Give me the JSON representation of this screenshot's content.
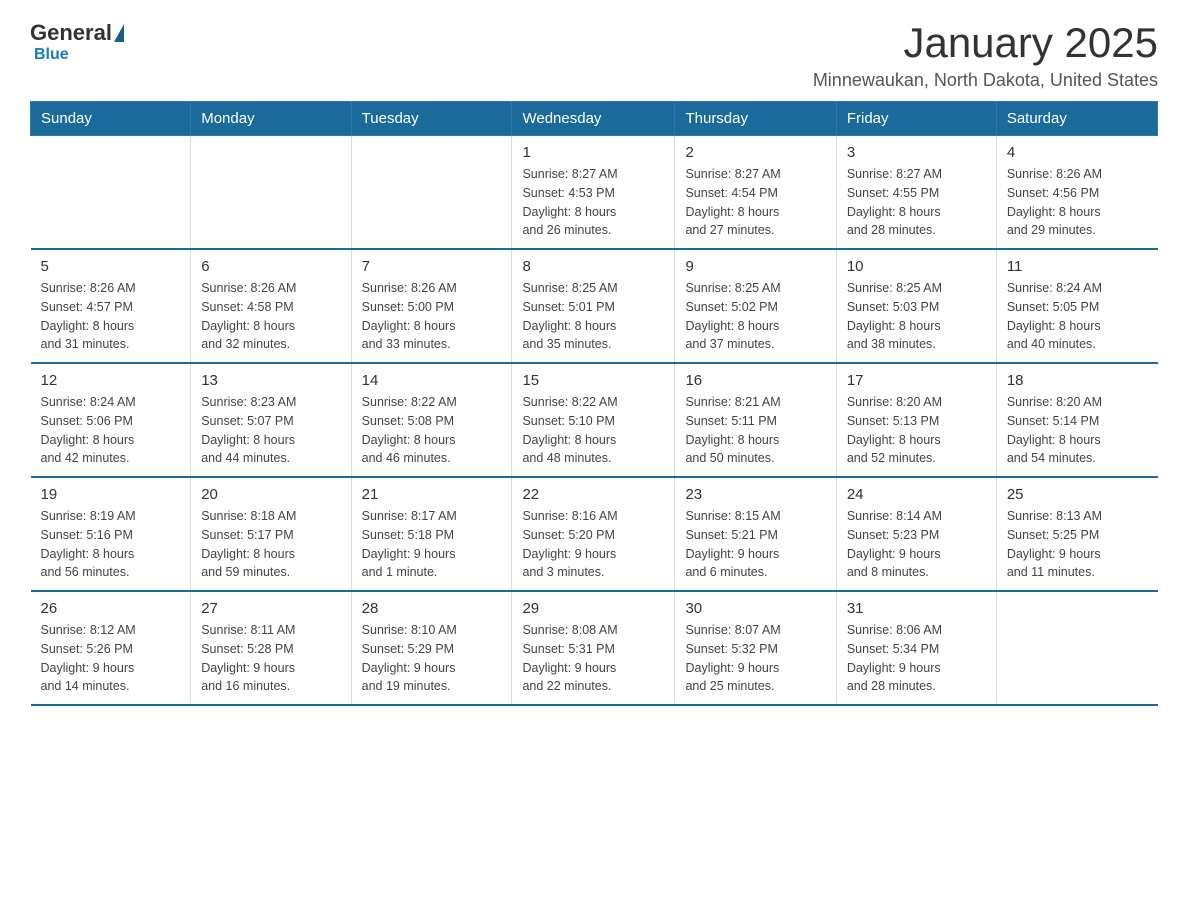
{
  "logo": {
    "general": "General",
    "blue": "Blue"
  },
  "header": {
    "month_title": "January 2025",
    "location": "Minnewaukan, North Dakota, United States"
  },
  "days_of_week": [
    "Sunday",
    "Monday",
    "Tuesday",
    "Wednesday",
    "Thursday",
    "Friday",
    "Saturday"
  ],
  "weeks": [
    [
      {
        "day": "",
        "info": ""
      },
      {
        "day": "",
        "info": ""
      },
      {
        "day": "",
        "info": ""
      },
      {
        "day": "1",
        "info": "Sunrise: 8:27 AM\nSunset: 4:53 PM\nDaylight: 8 hours\nand 26 minutes."
      },
      {
        "day": "2",
        "info": "Sunrise: 8:27 AM\nSunset: 4:54 PM\nDaylight: 8 hours\nand 27 minutes."
      },
      {
        "day": "3",
        "info": "Sunrise: 8:27 AM\nSunset: 4:55 PM\nDaylight: 8 hours\nand 28 minutes."
      },
      {
        "day": "4",
        "info": "Sunrise: 8:26 AM\nSunset: 4:56 PM\nDaylight: 8 hours\nand 29 minutes."
      }
    ],
    [
      {
        "day": "5",
        "info": "Sunrise: 8:26 AM\nSunset: 4:57 PM\nDaylight: 8 hours\nand 31 minutes."
      },
      {
        "day": "6",
        "info": "Sunrise: 8:26 AM\nSunset: 4:58 PM\nDaylight: 8 hours\nand 32 minutes."
      },
      {
        "day": "7",
        "info": "Sunrise: 8:26 AM\nSunset: 5:00 PM\nDaylight: 8 hours\nand 33 minutes."
      },
      {
        "day": "8",
        "info": "Sunrise: 8:25 AM\nSunset: 5:01 PM\nDaylight: 8 hours\nand 35 minutes."
      },
      {
        "day": "9",
        "info": "Sunrise: 8:25 AM\nSunset: 5:02 PM\nDaylight: 8 hours\nand 37 minutes."
      },
      {
        "day": "10",
        "info": "Sunrise: 8:25 AM\nSunset: 5:03 PM\nDaylight: 8 hours\nand 38 minutes."
      },
      {
        "day": "11",
        "info": "Sunrise: 8:24 AM\nSunset: 5:05 PM\nDaylight: 8 hours\nand 40 minutes."
      }
    ],
    [
      {
        "day": "12",
        "info": "Sunrise: 8:24 AM\nSunset: 5:06 PM\nDaylight: 8 hours\nand 42 minutes."
      },
      {
        "day": "13",
        "info": "Sunrise: 8:23 AM\nSunset: 5:07 PM\nDaylight: 8 hours\nand 44 minutes."
      },
      {
        "day": "14",
        "info": "Sunrise: 8:22 AM\nSunset: 5:08 PM\nDaylight: 8 hours\nand 46 minutes."
      },
      {
        "day": "15",
        "info": "Sunrise: 8:22 AM\nSunset: 5:10 PM\nDaylight: 8 hours\nand 48 minutes."
      },
      {
        "day": "16",
        "info": "Sunrise: 8:21 AM\nSunset: 5:11 PM\nDaylight: 8 hours\nand 50 minutes."
      },
      {
        "day": "17",
        "info": "Sunrise: 8:20 AM\nSunset: 5:13 PM\nDaylight: 8 hours\nand 52 minutes."
      },
      {
        "day": "18",
        "info": "Sunrise: 8:20 AM\nSunset: 5:14 PM\nDaylight: 8 hours\nand 54 minutes."
      }
    ],
    [
      {
        "day": "19",
        "info": "Sunrise: 8:19 AM\nSunset: 5:16 PM\nDaylight: 8 hours\nand 56 minutes."
      },
      {
        "day": "20",
        "info": "Sunrise: 8:18 AM\nSunset: 5:17 PM\nDaylight: 8 hours\nand 59 minutes."
      },
      {
        "day": "21",
        "info": "Sunrise: 8:17 AM\nSunset: 5:18 PM\nDaylight: 9 hours\nand 1 minute."
      },
      {
        "day": "22",
        "info": "Sunrise: 8:16 AM\nSunset: 5:20 PM\nDaylight: 9 hours\nand 3 minutes."
      },
      {
        "day": "23",
        "info": "Sunrise: 8:15 AM\nSunset: 5:21 PM\nDaylight: 9 hours\nand 6 minutes."
      },
      {
        "day": "24",
        "info": "Sunrise: 8:14 AM\nSunset: 5:23 PM\nDaylight: 9 hours\nand 8 minutes."
      },
      {
        "day": "25",
        "info": "Sunrise: 8:13 AM\nSunset: 5:25 PM\nDaylight: 9 hours\nand 11 minutes."
      }
    ],
    [
      {
        "day": "26",
        "info": "Sunrise: 8:12 AM\nSunset: 5:26 PM\nDaylight: 9 hours\nand 14 minutes."
      },
      {
        "day": "27",
        "info": "Sunrise: 8:11 AM\nSunset: 5:28 PM\nDaylight: 9 hours\nand 16 minutes."
      },
      {
        "day": "28",
        "info": "Sunrise: 8:10 AM\nSunset: 5:29 PM\nDaylight: 9 hours\nand 19 minutes."
      },
      {
        "day": "29",
        "info": "Sunrise: 8:08 AM\nSunset: 5:31 PM\nDaylight: 9 hours\nand 22 minutes."
      },
      {
        "day": "30",
        "info": "Sunrise: 8:07 AM\nSunset: 5:32 PM\nDaylight: 9 hours\nand 25 minutes."
      },
      {
        "day": "31",
        "info": "Sunrise: 8:06 AM\nSunset: 5:34 PM\nDaylight: 9 hours\nand 28 minutes."
      },
      {
        "day": "",
        "info": ""
      }
    ]
  ]
}
